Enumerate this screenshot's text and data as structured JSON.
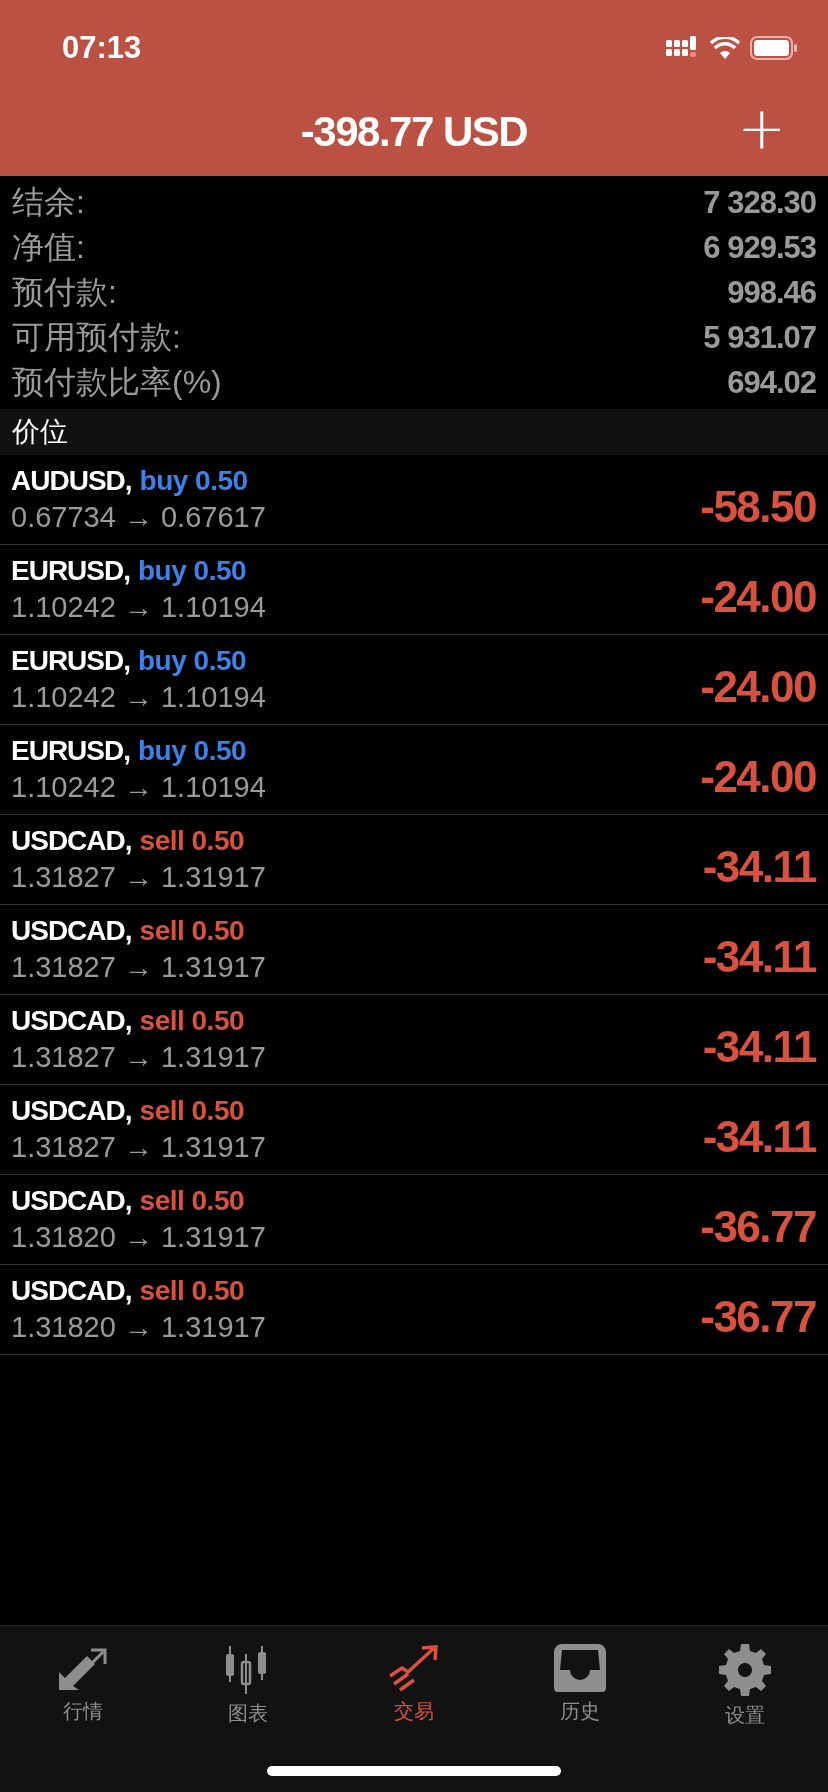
{
  "status_bar": {
    "time": "07:13"
  },
  "header": {
    "title": "-398.77 USD",
    "add_button": "+"
  },
  "summary": [
    {
      "label": "结余:",
      "value": "7 328.30"
    },
    {
      "label": "净值:",
      "value": "6 929.53"
    },
    {
      "label": "预付款:",
      "value": "998.46"
    },
    {
      "label": "可用预付款:",
      "value": "5 931.07"
    },
    {
      "label": "预付款比率(%)",
      "value": "694.02"
    }
  ],
  "section_title": "价位",
  "positions": [
    {
      "symbol": "AUDUSD,",
      "kind": "buy",
      "action": "buy 0.50",
      "prices": "0.67734 → 0.67617",
      "profit": "-58.50"
    },
    {
      "symbol": "EURUSD,",
      "kind": "buy",
      "action": "buy 0.50",
      "prices": "1.10242 → 1.10194",
      "profit": "-24.00"
    },
    {
      "symbol": "EURUSD,",
      "kind": "buy",
      "action": "buy 0.50",
      "prices": "1.10242 → 1.10194",
      "profit": "-24.00"
    },
    {
      "symbol": "EURUSD,",
      "kind": "buy",
      "action": "buy 0.50",
      "prices": "1.10242 → 1.10194",
      "profit": "-24.00"
    },
    {
      "symbol": "USDCAD,",
      "kind": "sell",
      "action": "sell 0.50",
      "prices": "1.31827 → 1.31917",
      "profit": "-34.11"
    },
    {
      "symbol": "USDCAD,",
      "kind": "sell",
      "action": "sell 0.50",
      "prices": "1.31827 → 1.31917",
      "profit": "-34.11"
    },
    {
      "symbol": "USDCAD,",
      "kind": "sell",
      "action": "sell 0.50",
      "prices": "1.31827 → 1.31917",
      "profit": "-34.11"
    },
    {
      "symbol": "USDCAD,",
      "kind": "sell",
      "action": "sell 0.50",
      "prices": "1.31827 → 1.31917",
      "profit": "-34.11"
    },
    {
      "symbol": "USDCAD,",
      "kind": "sell",
      "action": "sell 0.50",
      "prices": "1.31820 → 1.31917",
      "profit": "-36.77"
    },
    {
      "symbol": "USDCAD,",
      "kind": "sell",
      "action": "sell 0.50",
      "prices": "1.31820 → 1.31917",
      "profit": "-36.77"
    }
  ],
  "tabs": [
    {
      "label": "行情",
      "selected": false
    },
    {
      "label": "图表",
      "selected": false
    },
    {
      "label": "交易",
      "selected": true
    },
    {
      "label": "历史",
      "selected": false
    },
    {
      "label": "设置",
      "selected": false
    }
  ]
}
